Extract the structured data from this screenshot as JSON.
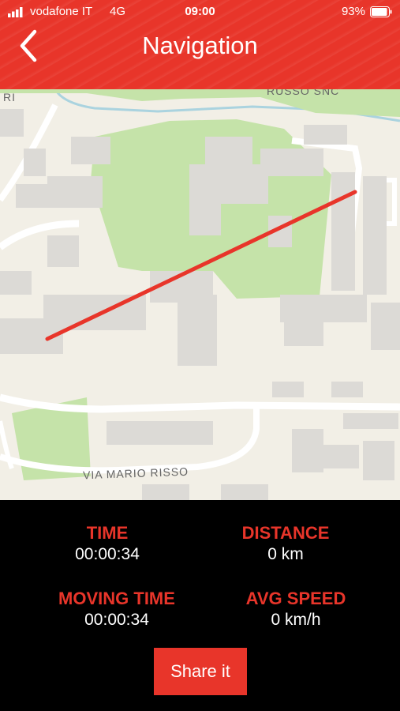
{
  "status_bar": {
    "carrier": "vodafone IT",
    "network": "4G",
    "time": "09:00",
    "battery": "93%",
    "battery_level": 0.93
  },
  "header": {
    "title": "Navigation",
    "back_icon": "chevron-left-icon"
  },
  "map": {
    "labels": {
      "top_left": "RI",
      "top_right": "RUSSO SNC",
      "street": "VIA MARIO RISSO"
    },
    "route_color": "#e8352a"
  },
  "stats": {
    "time": {
      "label": "TIME",
      "value": "00:00:34"
    },
    "distance": {
      "label": "DISTANCE",
      "value": "0 km"
    },
    "moving_time": {
      "label": "MOVING TIME",
      "value": "00:00:34"
    },
    "avg_speed": {
      "label": "AVG SPEED",
      "value": "0 km/h"
    }
  },
  "share_button": {
    "label": "Share it"
  },
  "colors": {
    "accent": "#e8352a",
    "background": "#000000"
  }
}
